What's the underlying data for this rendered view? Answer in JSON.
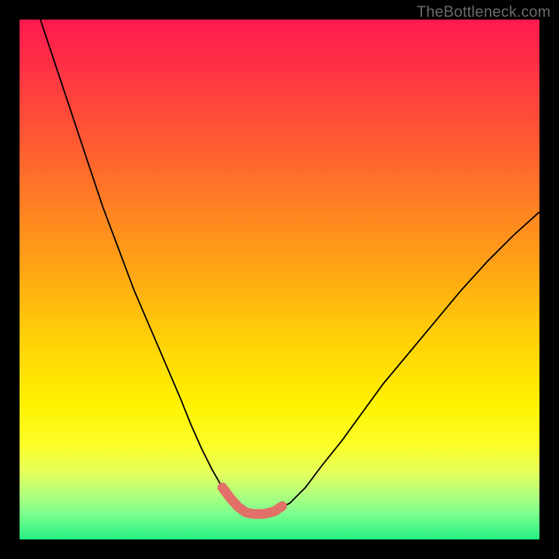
{
  "watermark": "TheBottleneck.com",
  "chart_data": {
    "type": "line",
    "title": "",
    "xlabel": "",
    "ylabel": "",
    "xlim": [
      0,
      100
    ],
    "ylim": [
      0,
      100
    ],
    "background_gradient": [
      "#ff1a4d",
      "#ff7e24",
      "#fff200",
      "#25ef83"
    ],
    "series": [
      {
        "name": "curve",
        "x": [
          4,
          7,
          10,
          13,
          16,
          19,
          22,
          25,
          28,
          31,
          33,
          35,
          37,
          39,
          40.5,
          42,
          43.5,
          45,
          47,
          49,
          52,
          55,
          58,
          62,
          66,
          70,
          75,
          80,
          85,
          90,
          95,
          100
        ],
        "values": [
          100,
          91,
          82,
          73,
          64,
          56,
          48,
          41,
          34,
          27,
          22,
          17.5,
          13.5,
          10,
          8,
          6.3,
          5.2,
          4.9,
          4.9,
          5.4,
          7,
          10,
          14,
          19,
          24.5,
          30,
          36,
          42,
          48,
          53.5,
          58.5,
          63
        ]
      }
    ],
    "highlight": {
      "name": "bottom-flat-marker",
      "color": "#e07068",
      "x": [
        39,
        40.5,
        42,
        43.5,
        45,
        47,
        49,
        50.5
      ],
      "values": [
        10,
        8,
        6.3,
        5.2,
        4.9,
        4.9,
        5.4,
        6.4
      ]
    }
  }
}
